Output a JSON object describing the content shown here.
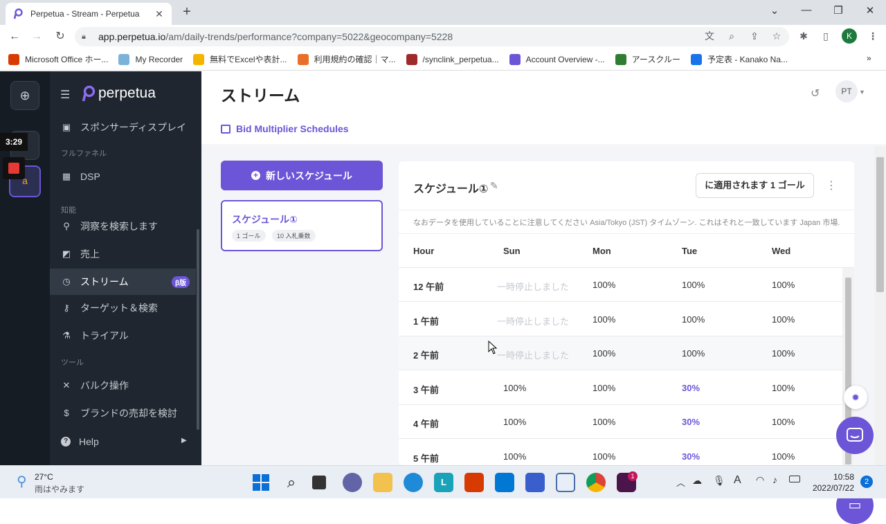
{
  "browser": {
    "tab_title": "Perpetua - Stream - Perpetua",
    "url_host": "app.perpetua.io",
    "url_path": "/am/daily-trends/performance?company=5022&geocompany=5228",
    "bookmarks": [
      {
        "label": "Microsoft Office ホー...",
        "color": "#d83b01"
      },
      {
        "label": "My Recorder",
        "color": "#7bb2d9"
      },
      {
        "label": "無料でExcelや表計...",
        "color": "#f4b400"
      },
      {
        "label": "利用規約の確認｜マ...",
        "color": "#e8702a"
      },
      {
        "label": "/synclink_perpetua...",
        "color": "#9e2a2b"
      },
      {
        "label": "Account Overview -...",
        "color": "#6c55d6"
      },
      {
        "label": "アースクルー",
        "color": "#2e7d32"
      },
      {
        "label": "予定表 - Kanako Na...",
        "color": "#1a73e8"
      }
    ],
    "profile_initial": "K"
  },
  "overlay": {
    "timer": "3:29"
  },
  "sidebar": {
    "brand": "perpetua",
    "items": [
      {
        "label": "スポンサーディスプレイ",
        "icon": "display-icon"
      },
      {
        "section": "フルファネル"
      },
      {
        "label": "DSP",
        "icon": "grid-icon"
      },
      {
        "section": "知能"
      },
      {
        "label": "洞察を検索します",
        "icon": "insight-icon"
      },
      {
        "label": "売上",
        "icon": "chart-icon"
      },
      {
        "label": "ストリーム",
        "icon": "clock-icon",
        "badge": "β版",
        "active": true
      },
      {
        "label": "ターゲット＆検索",
        "icon": "key-icon"
      },
      {
        "label": "トライアル",
        "icon": "flask-icon"
      },
      {
        "section": "ツール"
      },
      {
        "label": "バルク操作",
        "icon": "tools-icon"
      },
      {
        "label": "ブランドの売却を検討",
        "icon": "dollar-icon"
      },
      {
        "label": "Help",
        "icon": "help-icon"
      }
    ]
  },
  "header": {
    "title": "ストリーム",
    "subnav": "Bid Multiplier Schedules",
    "avatar": "PT"
  },
  "schedules": {
    "new_button": "新しいスケジュール",
    "list": [
      {
        "name": "スケジュール①",
        "tags": [
          "1 ゴール",
          "10 入札乗数"
        ]
      }
    ]
  },
  "detail": {
    "title": "スケジュール①",
    "applied_button": "に適用されます 1 ゴール",
    "note": "なおデータを使用していることに注意してください Asia/Tokyo (JST) タイムゾーン. これはそれと一致しています Japan 市場.",
    "columns": [
      "Hour",
      "Sun",
      "Mon",
      "Tue",
      "Wed"
    ],
    "rows": [
      [
        "12 午前",
        "一時停止しました",
        "100%",
        "100%",
        "100%"
      ],
      [
        "1 午前",
        "一時停止しました",
        "100%",
        "100%",
        "100%"
      ],
      [
        "2 午前",
        "一時停止しました",
        "100%",
        "100%",
        "100%"
      ],
      [
        "3 午前",
        "100%",
        "100%",
        "30%",
        "100%"
      ],
      [
        "4 午前",
        "100%",
        "100%",
        "30%",
        "100%"
      ],
      [
        "5 午前",
        "100%",
        "100%",
        "30%",
        "100%"
      ]
    ]
  },
  "taskbar": {
    "weather_temp": "27°C",
    "weather_desc": "雨はやみます",
    "time": "10:58",
    "date": "2022/07/22",
    "notif_count": "2",
    "slack_badge": "1"
  },
  "colors": {
    "accent": "#6c55d6",
    "sidebar": "#1f262f",
    "rail": "#161c24"
  }
}
